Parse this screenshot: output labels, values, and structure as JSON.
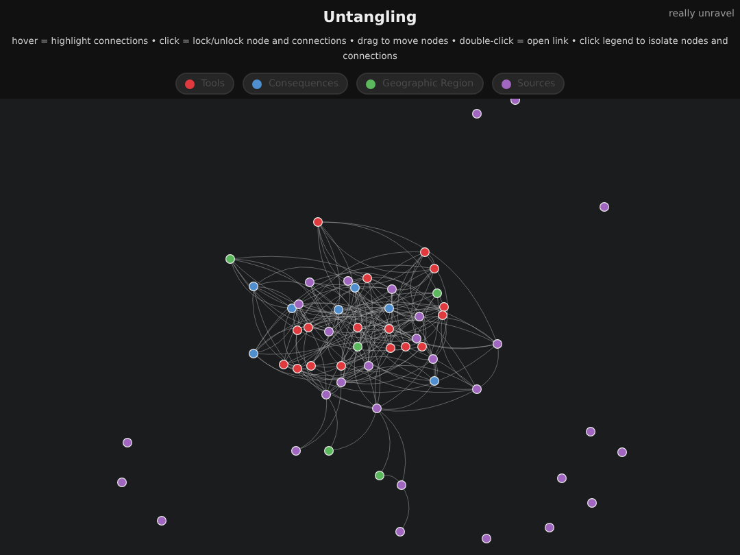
{
  "header": {
    "title": "Untangling",
    "corner_note": "really unravel",
    "instructions": "hover = highlight connections • click = lock/unlock node and connections • drag to move nodes • double-click = open link • click legend to isolate nodes and connections"
  },
  "legend": [
    {
      "label": "Tools",
      "color": "#e03a3e"
    },
    {
      "label": "Consequences",
      "color": "#4f8fcf"
    },
    {
      "label": "Geographic Region",
      "color": "#5cb85c"
    },
    {
      "label": "Sources",
      "color": "#a066c0"
    }
  ]
}
